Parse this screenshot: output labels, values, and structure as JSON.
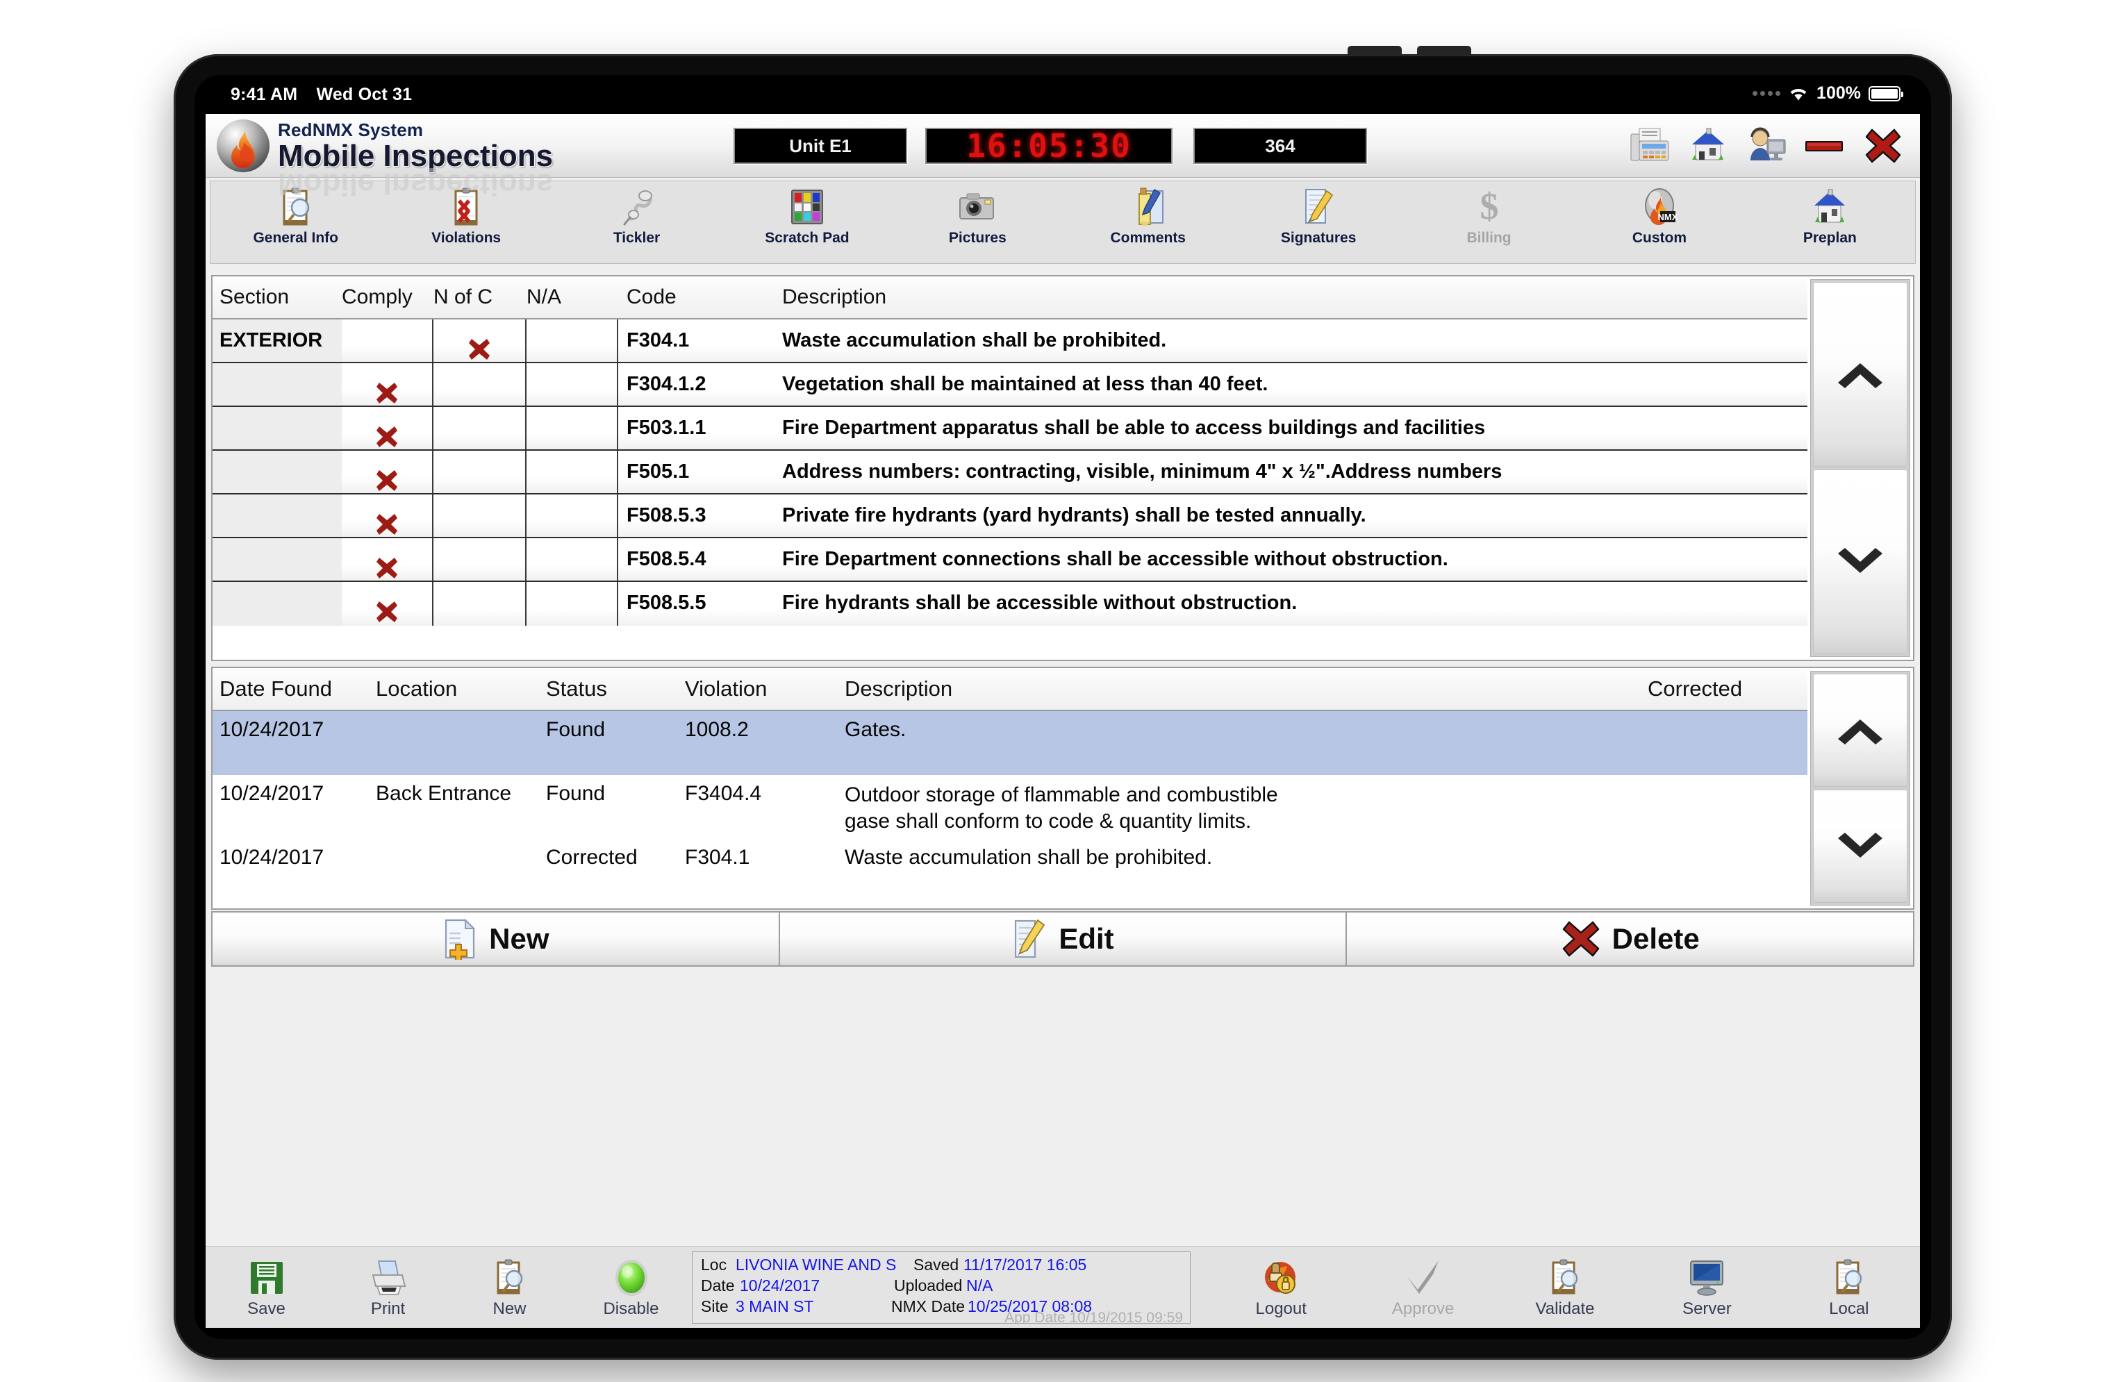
{
  "ios_status": {
    "time": "9:41 AM",
    "date": "Wed Oct 31",
    "battery_pct": "100%"
  },
  "brand": {
    "system": "RedNMX System",
    "app": "Mobile Inspections"
  },
  "header": {
    "unit": "Unit E1",
    "clock": "16:05:30",
    "counter": "364",
    "icons": [
      {
        "name": "fax-icon"
      },
      {
        "name": "home-icon"
      },
      {
        "name": "support-agent-icon"
      },
      {
        "name": "minimize-icon"
      },
      {
        "name": "close-icon"
      }
    ]
  },
  "toolbar": {
    "items": [
      {
        "label": "General Info",
        "icon": "clipboard-magnifier-icon",
        "disabled": false
      },
      {
        "label": "Violations",
        "icon": "clipboard-violations-icon",
        "disabled": false
      },
      {
        "label": "Tickler",
        "icon": "phone-receiver-icon",
        "disabled": false
      },
      {
        "label": "Scratch Pad",
        "icon": "color-palette-icon",
        "disabled": false
      },
      {
        "label": "Pictures",
        "icon": "camera-icon",
        "disabled": false
      },
      {
        "label": "Comments",
        "icon": "pencil-notes-icon",
        "disabled": false
      },
      {
        "label": "Signatures",
        "icon": "signature-pencil-icon",
        "disabled": false
      },
      {
        "label": "Billing",
        "icon": "dollar-sign-icon",
        "disabled": true
      },
      {
        "label": "Custom",
        "icon": "nmx-flame-icon",
        "disabled": false
      },
      {
        "label": "Preplan",
        "icon": "house-icon",
        "disabled": false
      }
    ]
  },
  "code_table": {
    "headers": [
      "Section",
      "Comply",
      "N of C",
      "N/A",
      "Code",
      "Description"
    ],
    "rows": [
      {
        "section": "EXTERIOR",
        "comply": "",
        "noc": "x",
        "na": "",
        "code": "F304.1",
        "description": "Waste accumulation shall be prohibited."
      },
      {
        "section": "",
        "comply": "x",
        "noc": "",
        "na": "",
        "code": "F304.1.2",
        "description": "Vegetation shall be maintained at less than 40 feet."
      },
      {
        "section": "",
        "comply": "x",
        "noc": "",
        "na": "",
        "code": "F503.1.1",
        "description": "Fire Department apparatus shall be able to access buildings and facilities"
      },
      {
        "section": "",
        "comply": "x",
        "noc": "",
        "na": "",
        "code": "F505.1",
        "description": "Address numbers: contracting, visible, minimum 4\" x ½\".Address numbers"
      },
      {
        "section": "",
        "comply": "x",
        "noc": "",
        "na": "",
        "code": "F508.5.3",
        "description": "Private fire hydrants (yard hydrants) shall be tested annually."
      },
      {
        "section": "",
        "comply": "x",
        "noc": "",
        "na": "",
        "code": "F508.5.4",
        "description": "Fire Department connections shall be accessible without obstruction."
      },
      {
        "section": "",
        "comply": "x",
        "noc": "",
        "na": "",
        "code": "F508.5.5",
        "description": "Fire hydrants shall be accessible without obstruction."
      }
    ],
    "scroll_up": "scroll-up-chevron-icon",
    "scroll_down": "scroll-down-chevron-icon"
  },
  "violation_table": {
    "headers": [
      "Date Found",
      "Location",
      "Status",
      "Violation",
      "Description",
      "Corrected"
    ],
    "rows": [
      {
        "date_found": "10/24/2017",
        "location": "",
        "status": "Found",
        "violation": "1008.2",
        "description": "Gates.",
        "corrected": "",
        "selected": true
      },
      {
        "date_found": "10/24/2017",
        "location": "Back Entrance",
        "status": "Found",
        "violation": "F3404.4",
        "description": "Outdoor storage of flammable and combustible\ngase shall conform to code & quantity limits.",
        "corrected": "",
        "selected": false
      },
      {
        "date_found": "10/24/2017",
        "location": "",
        "status": "Corrected",
        "violation": "F304.1",
        "description": "Waste accumulation shall be prohibited.",
        "corrected": "",
        "selected": false
      }
    ],
    "scroll_up": "scroll-up-chevron-icon",
    "scroll_down": "scroll-down-chevron-icon"
  },
  "action_buttons": [
    {
      "label": "New",
      "icon": "new-document-plus-icon"
    },
    {
      "label": "Edit",
      "icon": "edit-pencil-icon"
    },
    {
      "label": "Delete",
      "icon": "delete-x-icon"
    }
  ],
  "footer": {
    "left_buttons": [
      {
        "label": "Save",
        "icon": "floppy-disk-icon",
        "disabled": false
      },
      {
        "label": "Print",
        "icon": "printer-icon",
        "disabled": false
      },
      {
        "label": "New",
        "icon": "clipboard-magnifier-icon",
        "disabled": false
      },
      {
        "label": "Disable",
        "icon": "green-status-light-icon",
        "disabled": false
      }
    ],
    "info": {
      "loc_label": "Loc",
      "loc_value": "LIVONIA WINE AND S",
      "date_label": "Date",
      "date_value": "10/24/2017",
      "site_label": "Site",
      "site_value": "3 MAIN ST",
      "saved_label": "Saved",
      "saved_value": "11/17/2017 16:05",
      "uploaded_label": "Uploaded",
      "uploaded_value": "N/A",
      "nmx_label": "NMX Date",
      "nmx_value": "10/25/2017 08:08",
      "app_label": "App Date",
      "app_value": "10/19/2015 09:59"
    },
    "right_buttons": [
      {
        "label": "Logout",
        "icon": "logout-lock-icon",
        "disabled": false
      },
      {
        "label": "Approve",
        "icon": "checkmark-icon",
        "disabled": true
      },
      {
        "label": "Validate",
        "icon": "clipboard-magnifier-icon",
        "disabled": false
      },
      {
        "label": "Server",
        "icon": "monitor-icon",
        "disabled": false
      },
      {
        "label": "Local",
        "icon": "clipboard-magnifier-icon",
        "disabled": false
      }
    ]
  },
  "colors": {
    "accent_red": "#b01b16",
    "lcd_red": "#e01010",
    "selection_blue": "#b6c6e4",
    "link_blue": "#1414e6"
  }
}
